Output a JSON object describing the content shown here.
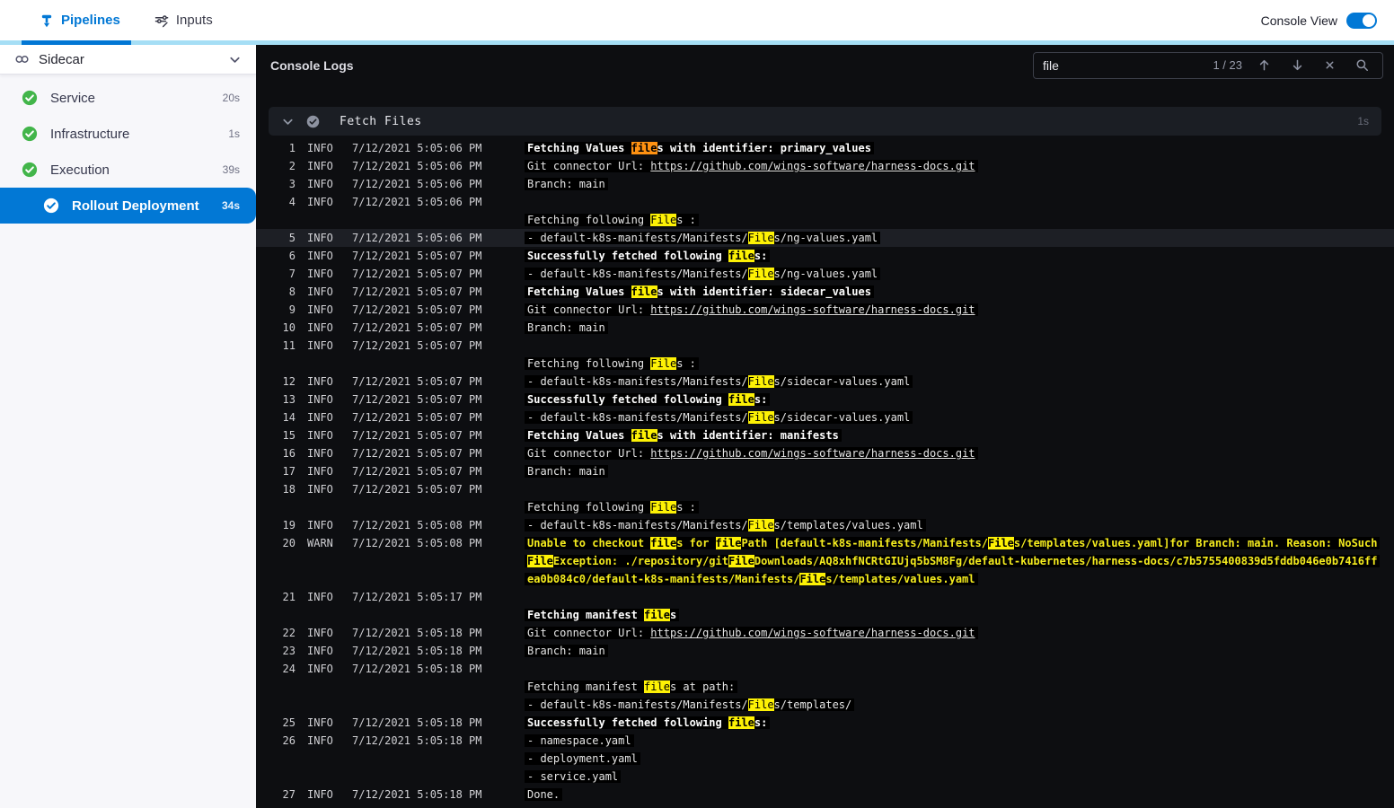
{
  "topbar": {
    "tabs": [
      {
        "label": "Pipelines",
        "icon": "pipeline",
        "active": true
      },
      {
        "label": "Inputs",
        "icon": "inputs",
        "active": false
      }
    ],
    "console_view_label": "Console View",
    "console_view_on": true
  },
  "sidebar": {
    "stage": {
      "label": "Sidecar",
      "icon": "link-icon"
    },
    "steps": [
      {
        "label": "Service",
        "duration": "20s",
        "status": "success",
        "selected": false,
        "indent": false
      },
      {
        "label": "Infrastructure",
        "duration": "1s",
        "status": "success",
        "selected": false,
        "indent": false
      },
      {
        "label": "Execution",
        "duration": "39s",
        "status": "success",
        "selected": false,
        "indent": false
      },
      {
        "label": "Rollout Deployment",
        "duration": "34s",
        "status": "success",
        "selected": true,
        "indent": true
      }
    ]
  },
  "console": {
    "title": "Console Logs",
    "search": {
      "value": "file",
      "counter": "1 / 23",
      "icons": [
        "arrow-up-icon",
        "arrow-down-icon",
        "close-icon",
        "search-icon"
      ]
    },
    "section": {
      "title": "Fetch Files",
      "duration": "1s",
      "status": "success",
      "collapsed": false
    },
    "colors": {
      "accent": "#0278d5",
      "success_green": "#42b54a",
      "match_highlight": "#fdf105",
      "current_match_highlight": "#ff9212",
      "warn_text": "#f5ec1e"
    },
    "log_lines": [
      {
        "num": "1",
        "level": "INFO",
        "time": "7/12/2021 5:05:06 PM",
        "style": "bold",
        "segments": [
          {
            "t": "Fetching Values "
          },
          {
            "t": "file",
            "mark": "current"
          },
          {
            "t": "s with identifier: primary_values"
          }
        ]
      },
      {
        "num": "2",
        "level": "INFO",
        "time": "7/12/2021 5:05:06 PM",
        "segments": [
          {
            "t": "Git connector Url: "
          },
          {
            "t": "https://github.com/wings-software/harness-docs.git",
            "link": true
          }
        ]
      },
      {
        "num": "3",
        "level": "INFO",
        "time": "7/12/2021 5:05:06 PM",
        "segments": [
          {
            "t": "Branch: main"
          }
        ]
      },
      {
        "num": "4",
        "level": "INFO",
        "time": "7/12/2021 5:05:06 PM",
        "segments": []
      },
      {
        "segments": [
          {
            "t": "Fetching following "
          },
          {
            "t": "File",
            "mark": "match"
          },
          {
            "t": "s :"
          }
        ]
      },
      {
        "num": "5",
        "level": "INFO",
        "time": "7/12/2021 5:05:06 PM",
        "selected": true,
        "segments": [
          {
            "t": "- default-k8s-manifests/Manifests/"
          },
          {
            "t": "File",
            "mark": "match"
          },
          {
            "t": "s/ng-values.yaml"
          }
        ]
      },
      {
        "num": "6",
        "level": "INFO",
        "time": "7/12/2021 5:05:07 PM",
        "style": "bold",
        "segments": [
          {
            "t": "Successfully fetched following "
          },
          {
            "t": "file",
            "mark": "match"
          },
          {
            "t": "s:"
          }
        ]
      },
      {
        "num": "7",
        "level": "INFO",
        "time": "7/12/2021 5:05:07 PM",
        "segments": [
          {
            "t": "- default-k8s-manifests/Manifests/"
          },
          {
            "t": "File",
            "mark": "match"
          },
          {
            "t": "s/ng-values.yaml"
          }
        ]
      },
      {
        "num": "8",
        "level": "INFO",
        "time": "7/12/2021 5:05:07 PM",
        "style": "bold",
        "segments": [
          {
            "t": "Fetching Values "
          },
          {
            "t": "file",
            "mark": "match"
          },
          {
            "t": "s with identifier: sidecar_values"
          }
        ]
      },
      {
        "num": "9",
        "level": "INFO",
        "time": "7/12/2021 5:05:07 PM",
        "segments": [
          {
            "t": "Git connector Url: "
          },
          {
            "t": "https://github.com/wings-software/harness-docs.git",
            "link": true
          }
        ]
      },
      {
        "num": "10",
        "level": "INFO",
        "time": "7/12/2021 5:05:07 PM",
        "segments": [
          {
            "t": "Branch: main"
          }
        ]
      },
      {
        "num": "11",
        "level": "INFO",
        "time": "7/12/2021 5:05:07 PM",
        "segments": []
      },
      {
        "segments": [
          {
            "t": "Fetching following "
          },
          {
            "t": "File",
            "mark": "match"
          },
          {
            "t": "s :"
          }
        ]
      },
      {
        "num": "12",
        "level": "INFO",
        "time": "7/12/2021 5:05:07 PM",
        "segments": [
          {
            "t": "- default-k8s-manifests/Manifests/"
          },
          {
            "t": "File",
            "mark": "match"
          },
          {
            "t": "s/sidecar-values.yaml"
          }
        ]
      },
      {
        "num": "13",
        "level": "INFO",
        "time": "7/12/2021 5:05:07 PM",
        "style": "bold",
        "segments": [
          {
            "t": "Successfully fetched following "
          },
          {
            "t": "file",
            "mark": "match"
          },
          {
            "t": "s:"
          }
        ]
      },
      {
        "num": "14",
        "level": "INFO",
        "time": "7/12/2021 5:05:07 PM",
        "segments": [
          {
            "t": "- default-k8s-manifests/Manifests/"
          },
          {
            "t": "File",
            "mark": "match"
          },
          {
            "t": "s/sidecar-values.yaml"
          }
        ]
      },
      {
        "num": "15",
        "level": "INFO",
        "time": "7/12/2021 5:05:07 PM",
        "style": "bold",
        "segments": [
          {
            "t": "Fetching Values "
          },
          {
            "t": "file",
            "mark": "match"
          },
          {
            "t": "s with identifier: manifests"
          }
        ]
      },
      {
        "num": "16",
        "level": "INFO",
        "time": "7/12/2021 5:05:07 PM",
        "segments": [
          {
            "t": "Git connector Url: "
          },
          {
            "t": "https://github.com/wings-software/harness-docs.git",
            "link": true
          }
        ]
      },
      {
        "num": "17",
        "level": "INFO",
        "time": "7/12/2021 5:05:07 PM",
        "segments": [
          {
            "t": "Branch: main"
          }
        ]
      },
      {
        "num": "18",
        "level": "INFO",
        "time": "7/12/2021 5:05:07 PM",
        "segments": []
      },
      {
        "segments": [
          {
            "t": "Fetching following "
          },
          {
            "t": "File",
            "mark": "match"
          },
          {
            "t": "s :"
          }
        ]
      },
      {
        "num": "19",
        "level": "INFO",
        "time": "7/12/2021 5:05:08 PM",
        "segments": [
          {
            "t": "- default-k8s-manifests/Manifests/"
          },
          {
            "t": "File",
            "mark": "match"
          },
          {
            "t": "s/templates/values.yaml"
          }
        ]
      },
      {
        "num": "20",
        "level": "WARN",
        "time": "7/12/2021 5:05:08 PM",
        "style": "bold",
        "segments": [
          {
            "t": "Unable to checkout "
          },
          {
            "t": "file",
            "mark": "match"
          },
          {
            "t": "s for "
          },
          {
            "t": "file",
            "mark": "match"
          },
          {
            "t": "Path [default-k8s-manifests/Manifests/"
          },
          {
            "t": "File",
            "mark": "match"
          },
          {
            "t": "s/templates/values.yaml]for Branch: main. Reason: NoSuch"
          },
          {
            "t": "File",
            "mark": "match"
          },
          {
            "t": "Exception: ./repository/git"
          },
          {
            "t": "File",
            "mark": "match"
          },
          {
            "t": "Downloads/AQ8xhfNCRtGIUjq5bSM8Fg/default-kubernetes/harness-docs/c7b5755400839d5fddb046e0b7416ffea0b084c0/default-k8s-manifests/Manifests/"
          },
          {
            "t": "File",
            "mark": "match"
          },
          {
            "t": "s/templates/values.yaml"
          }
        ]
      },
      {
        "num": "21",
        "level": "INFO",
        "time": "7/12/2021 5:05:17 PM",
        "segments": []
      },
      {
        "style": "bold",
        "segments": [
          {
            "t": "Fetching manifest "
          },
          {
            "t": "file",
            "mark": "match"
          },
          {
            "t": "s"
          }
        ]
      },
      {
        "num": "22",
        "level": "INFO",
        "time": "7/12/2021 5:05:18 PM",
        "segments": [
          {
            "t": "Git connector Url: "
          },
          {
            "t": "https://github.com/wings-software/harness-docs.git",
            "link": true
          }
        ]
      },
      {
        "num": "23",
        "level": "INFO",
        "time": "7/12/2021 5:05:18 PM",
        "segments": [
          {
            "t": "Branch: main"
          }
        ]
      },
      {
        "num": "24",
        "level": "INFO",
        "time": "7/12/2021 5:05:18 PM",
        "segments": []
      },
      {
        "segments": [
          {
            "t": "Fetching manifest "
          },
          {
            "t": "file",
            "mark": "match"
          },
          {
            "t": "s at path:"
          }
        ]
      },
      {
        "segments": [
          {
            "t": "- default-k8s-manifests/Manifests/"
          },
          {
            "t": "File",
            "mark": "match"
          },
          {
            "t": "s/templates/"
          }
        ]
      },
      {
        "num": "25",
        "level": "INFO",
        "time": "7/12/2021 5:05:18 PM",
        "style": "bold",
        "segments": [
          {
            "t": "Successfully fetched following "
          },
          {
            "t": "file",
            "mark": "match"
          },
          {
            "t": "s:"
          }
        ]
      },
      {
        "num": "26",
        "level": "INFO",
        "time": "7/12/2021 5:05:18 PM",
        "segments": [
          {
            "t": "- namespace.yaml"
          }
        ]
      },
      {
        "segments": [
          {
            "t": "- deployment.yaml"
          }
        ]
      },
      {
        "segments": [
          {
            "t": "- service.yaml"
          }
        ]
      },
      {
        "num": "27",
        "level": "INFO",
        "time": "7/12/2021 5:05:18 PM",
        "segments": [
          {
            "t": "Done."
          }
        ]
      }
    ]
  }
}
